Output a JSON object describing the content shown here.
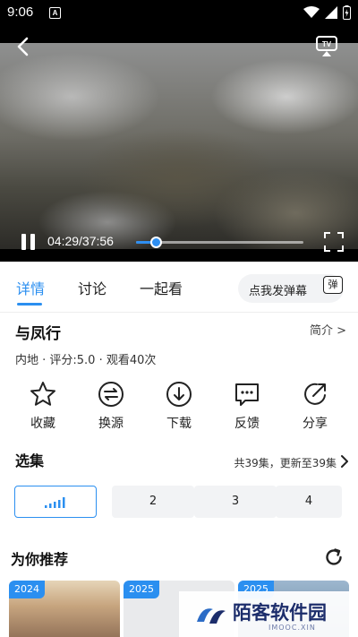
{
  "status_bar": {
    "time": "9:06",
    "notification_badge": "A",
    "icons": [
      "wifi-icon",
      "signal-icon",
      "battery-icon"
    ]
  },
  "player": {
    "current_time": "04:29",
    "duration": "37:56",
    "time_display": "04:29/37:56",
    "progress_fraction": 0.118,
    "accent_color": "#2f8ff1",
    "icons": [
      "back-icon",
      "cast-tv-icon",
      "pause-icon",
      "fullscreen-icon"
    ]
  },
  "tabs": {
    "items": [
      {
        "label": "详情",
        "active": true
      },
      {
        "label": "讨论",
        "active": false
      },
      {
        "label": "一起看",
        "active": false
      }
    ],
    "danmaku_prompt": "点我发弹幕",
    "danmaku_button": "弹"
  },
  "show": {
    "title": "与凤行",
    "intro_link": "简介 >",
    "meta": "内地 · 评分:5.0 · 观看40次"
  },
  "actions": [
    {
      "label": "收藏",
      "icon": "star-icon"
    },
    {
      "label": "换源",
      "icon": "switch-source-icon"
    },
    {
      "label": "下载",
      "icon": "download-icon"
    },
    {
      "label": "反馈",
      "icon": "feedback-icon"
    },
    {
      "label": "分享",
      "icon": "share-icon"
    }
  ],
  "episodes": {
    "title": "选集",
    "summary": "共39集，更新至39集",
    "items": [
      "",
      "2",
      "3",
      "4"
    ],
    "active_index": 0
  },
  "recommendations": {
    "title": "为你推荐",
    "cards": [
      {
        "year": "2024"
      },
      {
        "year": "2025"
      },
      {
        "year": "2025"
      }
    ]
  },
  "watermark": {
    "brand": "陌客软件园",
    "sub": "IMOOC.XIN"
  }
}
